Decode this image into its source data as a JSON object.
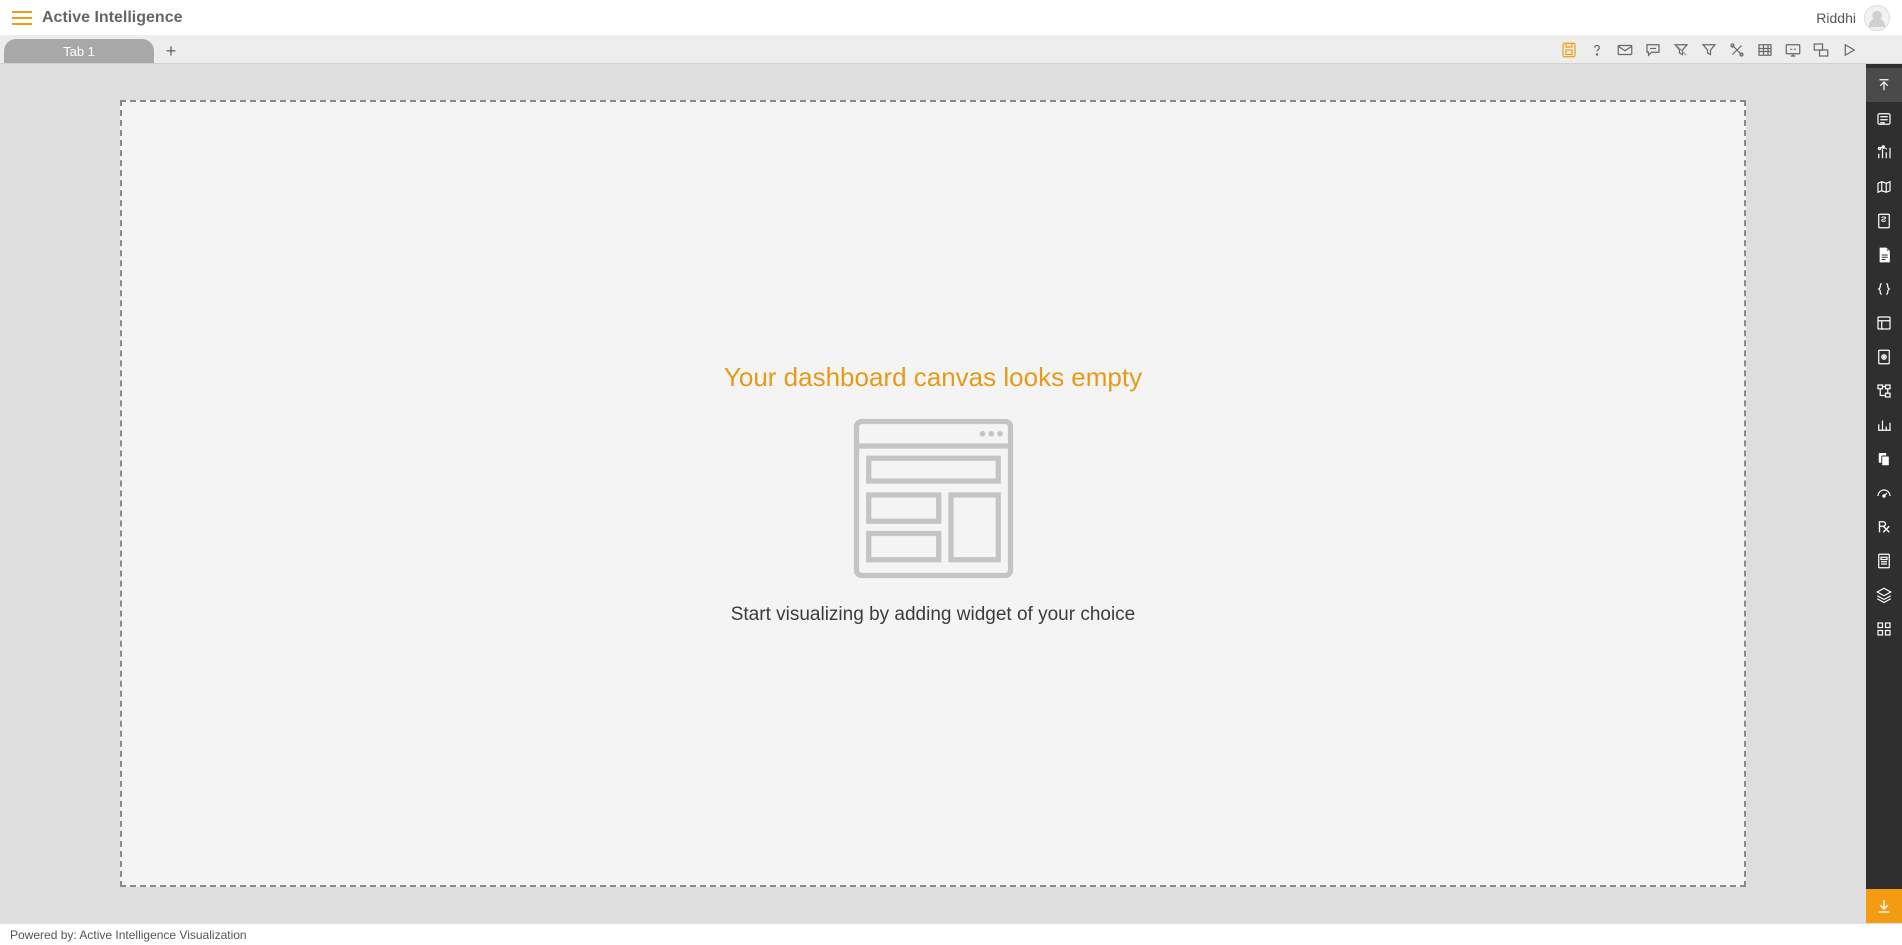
{
  "header": {
    "app_title": "Active Intelligence",
    "user_name": "Riddhi"
  },
  "tabs": {
    "items": [
      {
        "label": "Tab 1"
      }
    ],
    "add_label": "+"
  },
  "toolbar_icons": [
    "save-icon",
    "help-icon",
    "mail-icon",
    "comment-icon",
    "filter-cancel-icon",
    "filter-icon",
    "tools-icon",
    "grid-icon",
    "screen-icon",
    "layout-icon",
    "play-icon"
  ],
  "rail_icons": [
    "collapse-panel-icon",
    "form-widget-icon",
    "chart-widget-icon",
    "map-widget-icon",
    "formula-widget-icon",
    "document-widget-icon",
    "code-widget-icon",
    "card-widget-icon",
    "media-widget-icon",
    "hierarchy-widget-icon",
    "bar-widget-icon",
    "copy-widget-icon",
    "gauge-widget-icon",
    "rx-widget-icon",
    "report-widget-icon",
    "layers-widget-icon",
    "apps-widget-icon"
  ],
  "canvas": {
    "empty_title": "Your dashboard canvas looks empty",
    "empty_sub": "Start visualizing by adding widget of your choice"
  },
  "footer": {
    "text": "Powered by: Active Intelligence Visualization"
  },
  "colors": {
    "accent": "#f39c12",
    "rail_bg": "#2f2f2f",
    "canvas_bg": "#dedede"
  }
}
